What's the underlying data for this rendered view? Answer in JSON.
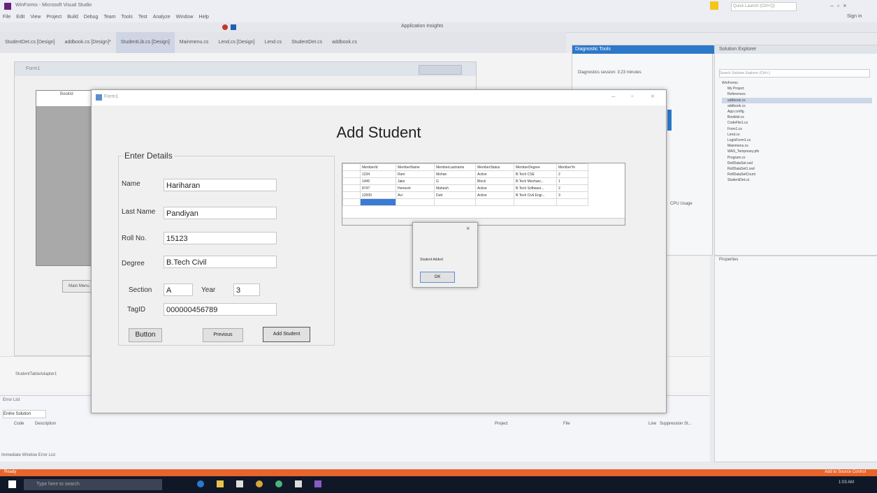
{
  "vs": {
    "title": "WinForms - Microsoft Visual Studio",
    "menu": [
      "File",
      "Edit",
      "View",
      "Project",
      "Build",
      "Debug",
      "Team",
      "Tools",
      "Test",
      "Analyze",
      "Window",
      "Help"
    ],
    "doc_tabs": [
      "StudentDet.cs [Design]",
      "addbook.cs [Design]*",
      "StudentLib.cs [Design]",
      "Mainmenu.cs",
      "Lend.cs [Design]",
      "Lend.cs",
      "StudentDet.cs",
      "addbook.cs"
    ],
    "toolbar_label": "Application Insights",
    "design_form_title": "Form1",
    "design_grid_header": "BookId",
    "main_menu_button": "Main Menu",
    "tray_item": "StudentTableAdapter1",
    "error_list_title": "Error List",
    "error_list_cols": [
      "Code",
      "Description",
      "Project",
      "File",
      "Line",
      "Suppression St..."
    ],
    "error_list_scope": "Entire Solution",
    "bottom_tabs": "Immediate Window   Error List",
    "diag_title": "Diagnostic Tools",
    "diag_session": "Diagnostics session: 3:23 minutes",
    "cpu_usage": "CPU Usage",
    "solexp_title": "Solution Explorer",
    "solexp_search": "Search Solution Explorer (Ctrl+;)",
    "solexp_items": [
      "WinForms",
      "My Project",
      "References",
      "addbook.cs",
      "addbook.cs",
      "App.config",
      "Booklist.cs",
      "CodeFile1.cs",
      "Form1.cs",
      "Lend.cs",
      "LoginForm1.cs",
      "Mainmenu.cs",
      "WAS_Temporary.pfx",
      "Program.cs",
      "RollDataSet.xsd",
      "RollDataSet1.xsd",
      "RollDataSetCount",
      "StudentDet.cs"
    ],
    "props_title": "Properties",
    "status": "Ready",
    "status_right": "Add to Source Control",
    "quick_launch": "Quick Launch (Ctrl+Q)",
    "sign_in": "Sign in",
    "taskbar_search": "Type here to search",
    "clock": "1:03 AM"
  },
  "form": {
    "title": "Form1",
    "heading": "Add Student",
    "group_label": "Enter Details",
    "fields": {
      "name_label": "Name",
      "name_value": "Hariharan",
      "lastname_label": "Last Name",
      "lastname_value": "Pandiyan",
      "roll_label": "Roll No.",
      "roll_value": "15123",
      "degree_label": "Degree",
      "degree_value": "B.Tech Civil",
      "section_label": "Section",
      "section_value": "A",
      "year_label": "Year",
      "year_value": "3",
      "tag_label": "TagID",
      "tag_value": "000000456789"
    },
    "buttons": {
      "button": "Button",
      "previous": "Previous",
      "add_student": "Add Student"
    },
    "grid": {
      "columns": [
        "MemberId",
        "MemberName",
        "MemberLastname",
        "MemberStatus",
        "MemberDegree",
        "MemberYe"
      ],
      "rows": [
        [
          "1234",
          "Ram",
          "Mohan",
          "Active",
          "B.Tech CSE",
          "2"
        ],
        [
          "1445",
          "Jake",
          "G",
          "Block",
          "B.Tech Mechani...",
          "1"
        ],
        [
          "8747",
          "Hemesh",
          "Mahesh",
          "Active",
          "B.Tech Software...",
          "2"
        ],
        [
          "12000",
          "Avi",
          "Dutt",
          "Active",
          "B.Tech Civil Engi...",
          "3"
        ]
      ]
    }
  },
  "msgbox": {
    "close": "×",
    "text": "Student Added",
    "ok": "OK"
  }
}
